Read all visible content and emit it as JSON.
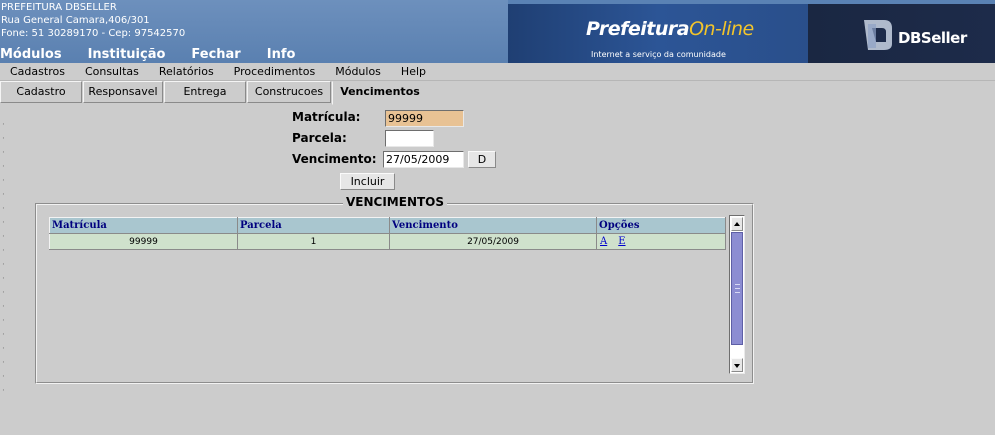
{
  "header": {
    "institution": "PREFEITURA DBSELLER",
    "address": "Rua General Camara,406/301",
    "contact": "Fone: 51 30289170  -  Cep: 97542570",
    "topnav": [
      "Módulos",
      "Instituição",
      "Fechar",
      "Info"
    ],
    "brand": {
      "title_main": "Prefeitura",
      "title_accent": "On-line",
      "subtitle": "Internet a serviço da comunidade"
    },
    "logo_text": "DBSeller"
  },
  "menubar": [
    "Cadastros",
    "Consultas",
    "Relatórios",
    "Procedimentos",
    "Módulos",
    "Help"
  ],
  "tabs": [
    "Cadastro",
    "Responsavel",
    "Entrega",
    "Construcoes",
    "Vencimentos"
  ],
  "active_tab": "Vencimentos",
  "form": {
    "matricula_label": "Matrícula:",
    "matricula_value": "99999",
    "parcela_label": "Parcela:",
    "parcela_value": "",
    "vencimento_label": "Vencimento:",
    "vencimento_value": "27/05/2009",
    "date_button": "D",
    "incluir_button": "Incluir"
  },
  "grid": {
    "legend": "VENCIMENTOS",
    "columns": [
      "Matrícula",
      "Parcela",
      "Vencimento",
      "Opções"
    ],
    "rows": [
      {
        "matricula": "99999",
        "parcela": "1",
        "vencimento": "27/05/2009",
        "opt_a": "A",
        "opt_e": "E"
      }
    ]
  },
  "colors": {
    "header_blue": "#5a82b4",
    "grid_header": "#a9c6cf",
    "grid_row": "#cfe1cc",
    "readonly_field": "#e8c294",
    "scroll_thumb": "#8c8dd2"
  }
}
